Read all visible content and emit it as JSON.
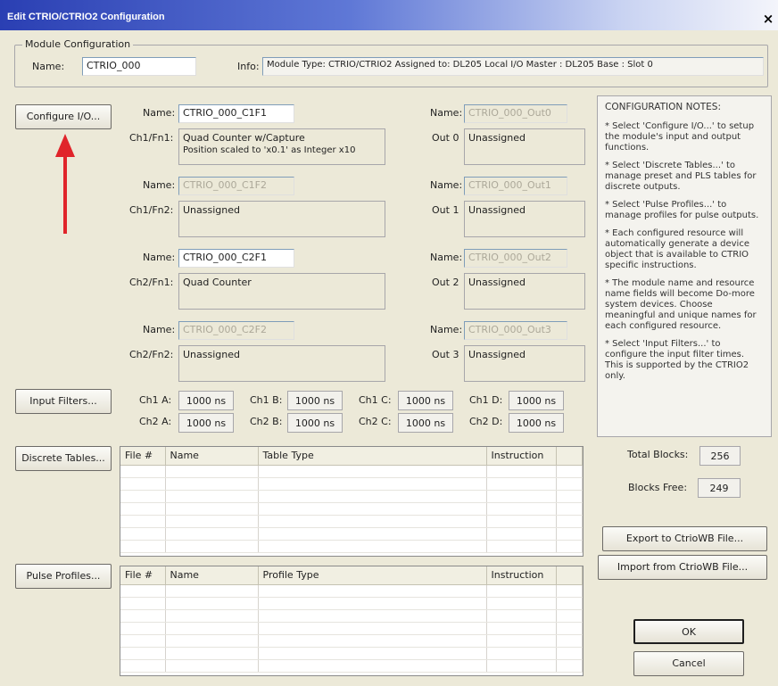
{
  "window": {
    "title": "Edit CTRIO/CTRIO2 Configuration",
    "close": "×"
  },
  "module": {
    "group_title": "Module Configuration",
    "name_label": "Name:",
    "name_value": "CTRIO_000",
    "info_label": "Info:",
    "info_value": "Module Type: CTRIO/CTRIO2   Assigned to: DL205 Local I/O Master : DL205 Base : Slot 0"
  },
  "buttons": {
    "configure_io": "Configure I/O...",
    "input_filters": "Input Filters...",
    "discrete_tables": "Discrete Tables...",
    "pulse_profiles": "Pulse Profiles...",
    "export": "Export to CtrioWB File...",
    "import": "Import  from CtrioWB File...",
    "ok": "OK",
    "cancel": "Cancel"
  },
  "inputs": [
    {
      "name_label": "Name:",
      "name": "CTRIO_000_C1F1",
      "enabled": true,
      "fn_label": "Ch1/Fn1:",
      "fn_line1": "Quad Counter w/Capture",
      "fn_line2": "Position scaled to 'x0.1' as Integer x10"
    },
    {
      "name_label": "Name:",
      "name": "CTRIO_000_C1F2",
      "enabled": false,
      "fn_label": "Ch1/Fn2:",
      "fn_line1": "Unassigned",
      "fn_line2": ""
    },
    {
      "name_label": "Name:",
      "name": "CTRIO_000_C2F1",
      "enabled": true,
      "fn_label": "Ch2/Fn1:",
      "fn_line1": "Quad Counter",
      "fn_line2": ""
    },
    {
      "name_label": "Name:",
      "name": "CTRIO_000_C2F2",
      "enabled": false,
      "fn_label": "Ch2/Fn2:",
      "fn_line1": "Unassigned",
      "fn_line2": ""
    }
  ],
  "outputs": [
    {
      "name_label": "Name:",
      "name": "CTRIO_000_Out0",
      "out_label": "Out 0",
      "value": "Unassigned"
    },
    {
      "name_label": "Name:",
      "name": "CTRIO_000_Out1",
      "out_label": "Out 1",
      "value": "Unassigned"
    },
    {
      "name_label": "Name:",
      "name": "CTRIO_000_Out2",
      "out_label": "Out 2",
      "value": "Unassigned"
    },
    {
      "name_label": "Name:",
      "name": "CTRIO_000_Out3",
      "out_label": "Out 3",
      "value": "Unassigned"
    }
  ],
  "filters": [
    {
      "label": "Ch1 A:",
      "value": "1000 ns"
    },
    {
      "label": "Ch1 B:",
      "value": "1000 ns"
    },
    {
      "label": "Ch1 C:",
      "value": "1000 ns"
    },
    {
      "label": "Ch1 D:",
      "value": "1000 ns"
    },
    {
      "label": "Ch2 A:",
      "value": "1000 ns"
    },
    {
      "label": "Ch2 B:",
      "value": "1000 ns"
    },
    {
      "label": "Ch2 C:",
      "value": "1000 ns"
    },
    {
      "label": "Ch2 D:",
      "value": "1000 ns"
    }
  ],
  "discrete_table": {
    "columns": [
      "File #",
      "Name",
      "Table Type",
      "Instruction",
      ""
    ]
  },
  "pulse_table": {
    "columns": [
      "File #",
      "Name",
      "Profile Type",
      "Instruction",
      ""
    ]
  },
  "notes": {
    "title": "CONFIGURATION NOTES:",
    "items": [
      "* Select 'Configure I/O...' to setup the module's input and output functions.",
      "* Select 'Discrete Tables...' to manage preset and PLS tables for discrete outputs.",
      "* Select 'Pulse Profiles...' to manage profiles for pulse outputs.",
      "* Each configured resource will automatically generate a device object that is available to CTRIO specific instructions.",
      "* The module name and resource name fields will become Do-more system devices. Choose meaningful and unique names for each configured resource.",
      "* Select 'Input Filters...' to configure the input filter times. This is supported by the CTRIO2 only."
    ]
  },
  "blocks": {
    "total_label": "Total Blocks:",
    "total_value": "256",
    "free_label": "Blocks Free:",
    "free_value": "249"
  },
  "colors": {
    "arrow": "#e0242a",
    "title_start": "#2a3fb3"
  }
}
